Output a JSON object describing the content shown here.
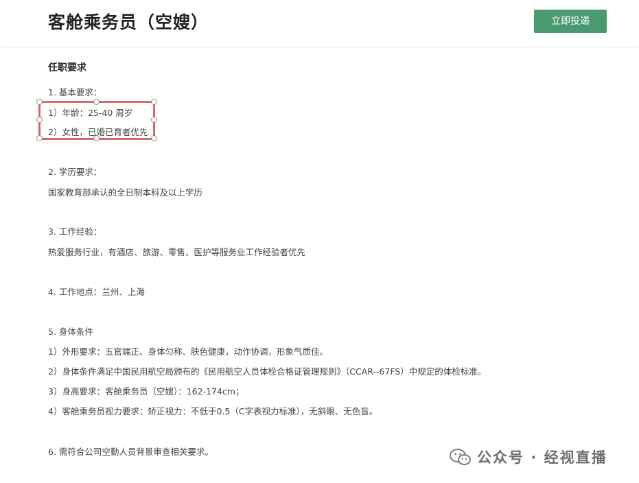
{
  "header": {
    "title": "客舱乘务员（空嫂）",
    "apply_button": "立即投递"
  },
  "colors": {
    "accent": "#4a9a70",
    "selection": "#d9666b"
  },
  "requirements": {
    "section_title": "任职要求",
    "basic": {
      "heading": "1. 基本要求：",
      "items": [
        "1）年龄：25-40 周岁",
        "2）女性，已婚已育者优先"
      ]
    },
    "education": {
      "heading": "2. 学历要求：",
      "text": "国家教育部承认的全日制本科及以上学历"
    },
    "experience": {
      "heading": "3. 工作经验：",
      "text": "热爱服务行业，有酒店、旅游、零售、医护等服务业工作经验者优先"
    },
    "location": {
      "text": "4. 工作地点：兰州、上海"
    },
    "physical": {
      "heading": "5. 身体条件",
      "items": [
        "1）外形要求：五官端正、身体匀称、肤色健康，动作协调，形象气质佳。",
        "2）身体条件满足中国民用航空局颁布的《民用航空人员体检合格证管理规则》（CCAR--67FS）中规定的体检标准。",
        "3）身高要求：客舱乘务员（空嫂）：162-174cm；",
        "4）客舱乘务员视力要求：矫正视力：不低于0.5（C字表视力标准），无斜眼、无色盲。"
      ]
    },
    "background": {
      "text": "6. 需符合公司空勤人员背景审查相关要求。"
    }
  },
  "watermark": {
    "icon": "wechat-icon",
    "text": "公众号 · 经视直播"
  }
}
